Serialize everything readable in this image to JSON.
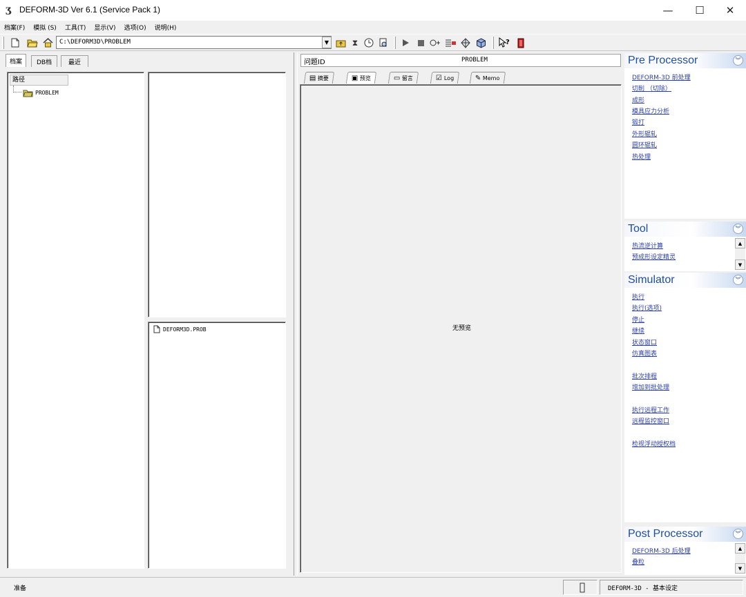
{
  "window": {
    "title": "DEFORM-3D  Ver 6.1 (Service Pack 1)",
    "minimize": "—",
    "maximize": "☐",
    "close": "✕"
  },
  "menu": [
    "档案(F)",
    "模拟 (S)",
    "工具(T)",
    "显示(V)",
    "选项(O)",
    "说明(H)"
  ],
  "toolbar": {
    "path": "C:\\DEFORM3D\\PROBLEM"
  },
  "left_tabs": [
    "档案",
    "DB档",
    "最近"
  ],
  "tree": {
    "header": "路径",
    "root": "PROBLEM"
  },
  "files": [
    "DEFORM3D.PROB"
  ],
  "problem": {
    "id_label": "问题ID",
    "id_value": "PROBLEM"
  },
  "mid_tabs": [
    "摘要",
    "预览",
    "留言",
    "Log",
    "Memo"
  ],
  "preview": {
    "empty_text": "无预览"
  },
  "sections": {
    "pre": {
      "title": "Pre Processor",
      "links": [
        "DEFORM-3D 前处理",
        "切削 （切除）",
        "成形",
        "模具应力分析",
        "锻打",
        "外形辊轧",
        "圆环辊轧",
        "热处理"
      ]
    },
    "tool": {
      "title": "Tool",
      "links": [
        "热流逆计算",
        "预成形设定精灵"
      ]
    },
    "sim": {
      "title": "Simulator",
      "links_a": [
        "执行",
        "执行(选项)",
        "停止",
        "继续",
        "状态窗口",
        "仿真图表"
      ],
      "links_b": [
        "批次排程",
        "增加到批处理"
      ],
      "links_c": [
        "执行远程工作",
        "远程监控窗口"
      ],
      "links_d": [
        "检视浮动授权档"
      ]
    },
    "post": {
      "title": "Post Processor",
      "links": [
        "DEFORM-3D 后处理",
        "叠粒"
      ]
    }
  },
  "status": {
    "left": "准备",
    "right": "DEFORM-3D  -  基本设定"
  }
}
